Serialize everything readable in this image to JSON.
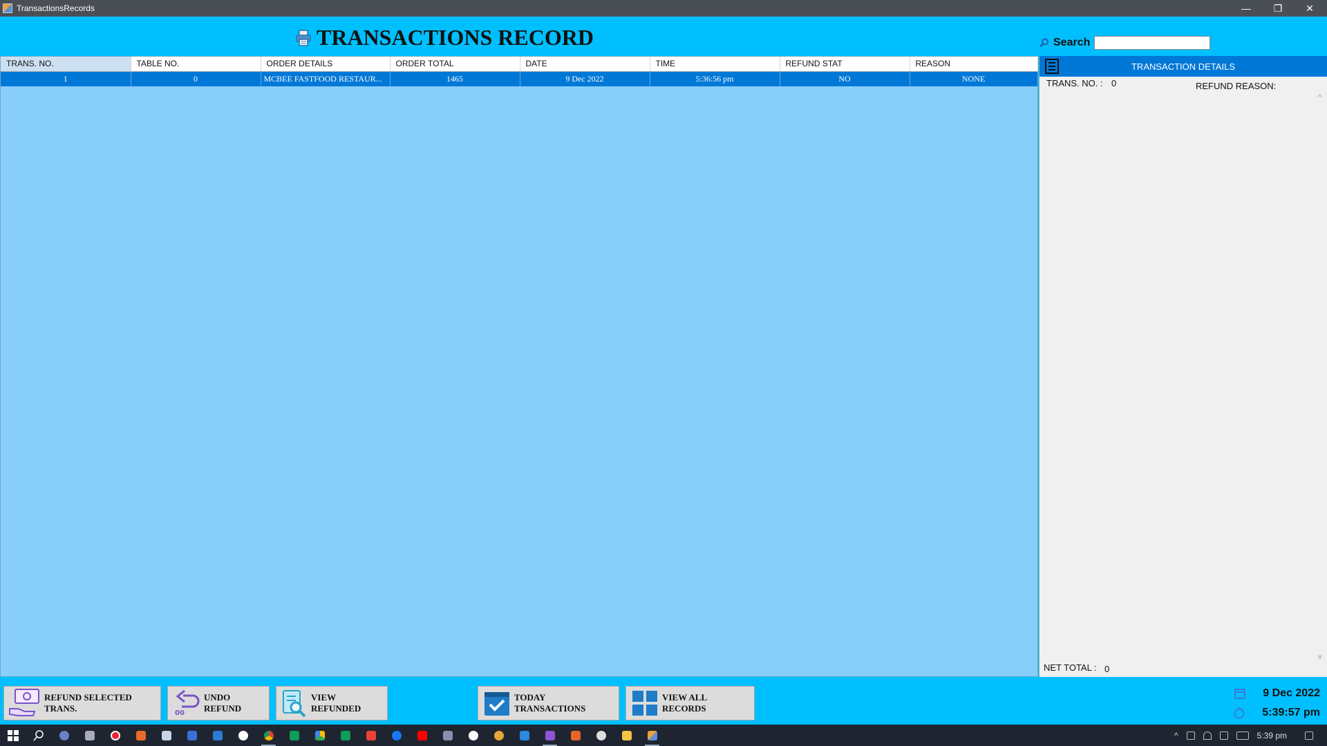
{
  "window": {
    "title": "TransactionsRecords",
    "min": "—",
    "restore": "❐",
    "close": "✕"
  },
  "header": {
    "title": "TRANSACTIONS RECORD",
    "search_label": "Search",
    "search_value": ""
  },
  "table": {
    "columns": [
      "TRANS. NO.",
      "TABLE NO.",
      "ORDER DETAILS",
      "ORDER TOTAL",
      "DATE",
      "TIME",
      "REFUND STAT",
      "REASON"
    ],
    "rows": [
      [
        "1",
        "0",
        "MCBEE FASTFOOD RESTAUR...",
        "1465",
        "9 Dec 2022",
        "5:36:56 pm",
        "NO",
        "NONE"
      ]
    ]
  },
  "details": {
    "title": "TRANSACTION DETAILS",
    "trans_label": "TRANS. NO.  :",
    "trans_value": "0",
    "refund_reason_label": "REFUND REASON:",
    "net_total_label": "NET TOTAL :",
    "net_total_value": "0"
  },
  "buttons": {
    "refund": "REFUND SELECTED TRANS.",
    "undo": "UNDO REFUND",
    "view_refunded": "VIEW REFUNDED",
    "today": "TODAY TRANSACTIONS",
    "view_all": "VIEW ALL RECORDS"
  },
  "clock": {
    "date": "9 Dec 2022",
    "time": "5:39:57 pm"
  },
  "taskbar": {
    "time": "5:39 pm"
  },
  "colors": {
    "accent": "#00bfff",
    "grid_bg": "#87cefa",
    "selection": "#0078d7"
  }
}
